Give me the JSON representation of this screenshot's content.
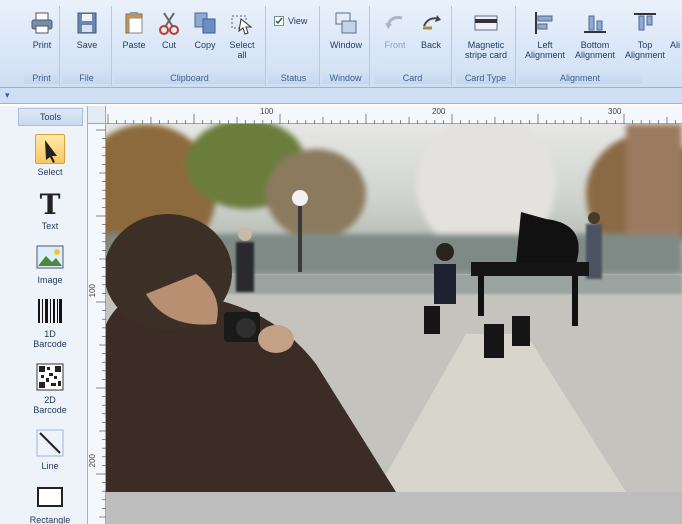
{
  "ribbon": {
    "groups": [
      {
        "label": "Print",
        "buttons": [
          {
            "label": "Print",
            "icon": "printer-icon"
          }
        ]
      },
      {
        "label": "File",
        "buttons": [
          {
            "label": "Save",
            "icon": "save-icon"
          }
        ]
      },
      {
        "label": "Clipboard",
        "buttons": [
          {
            "label": "Paste",
            "icon": "paste-icon"
          },
          {
            "label": "Cut",
            "icon": "cut-icon"
          },
          {
            "label": "Copy",
            "icon": "copy-icon"
          },
          {
            "label": "Select all",
            "icon": "select-all-icon"
          }
        ]
      },
      {
        "label": "Status",
        "buttons": [
          {
            "label": "View",
            "icon": "checkbox-icon",
            "checked": true
          }
        ]
      },
      {
        "label": "Window",
        "buttons": [
          {
            "label": "Window",
            "icon": "window-icon"
          }
        ]
      },
      {
        "label": "Card",
        "buttons": [
          {
            "label": "Front",
            "icon": "front-icon",
            "disabled": true
          },
          {
            "label": "Back",
            "icon": "back-icon"
          }
        ]
      },
      {
        "label": "Card Type",
        "buttons": [
          {
            "label": "Magnetic stripe card",
            "icon": "magnetic-stripe-icon"
          }
        ]
      },
      {
        "label": "Alignment",
        "buttons": [
          {
            "label": "Left Alignment",
            "icon": "left-align-icon"
          },
          {
            "label": "Bottom Alignment",
            "icon": "bottom-align-icon"
          },
          {
            "label": "Top Alignment",
            "icon": "top-align-icon"
          },
          {
            "label": "Ali",
            "icon": "align-icon"
          }
        ]
      }
    ]
  },
  "quick_access": {
    "arrow": "▾"
  },
  "tools": {
    "header": "Tools",
    "items": [
      {
        "label": "Select",
        "icon": "select-arrow-icon",
        "active": true
      },
      {
        "label": "Text",
        "icon": "text-icon"
      },
      {
        "label": "Image",
        "icon": "image-icon"
      },
      {
        "label": "1D Barcode",
        "icon": "barcode-1d-icon"
      },
      {
        "label": "2D Barcode",
        "icon": "barcode-2d-icon"
      },
      {
        "label": "Line",
        "icon": "line-icon"
      },
      {
        "label": "Rectangle",
        "icon": "rectangle-icon"
      }
    ]
  },
  "rulers": {
    "horizontal": [
      "100",
      "200",
      "300"
    ],
    "vertical": [
      "100",
      "200"
    ]
  },
  "colors": {
    "accent": "#1e395b",
    "ribbon": "#d9e6f7",
    "active_tool": "#f8c860"
  }
}
